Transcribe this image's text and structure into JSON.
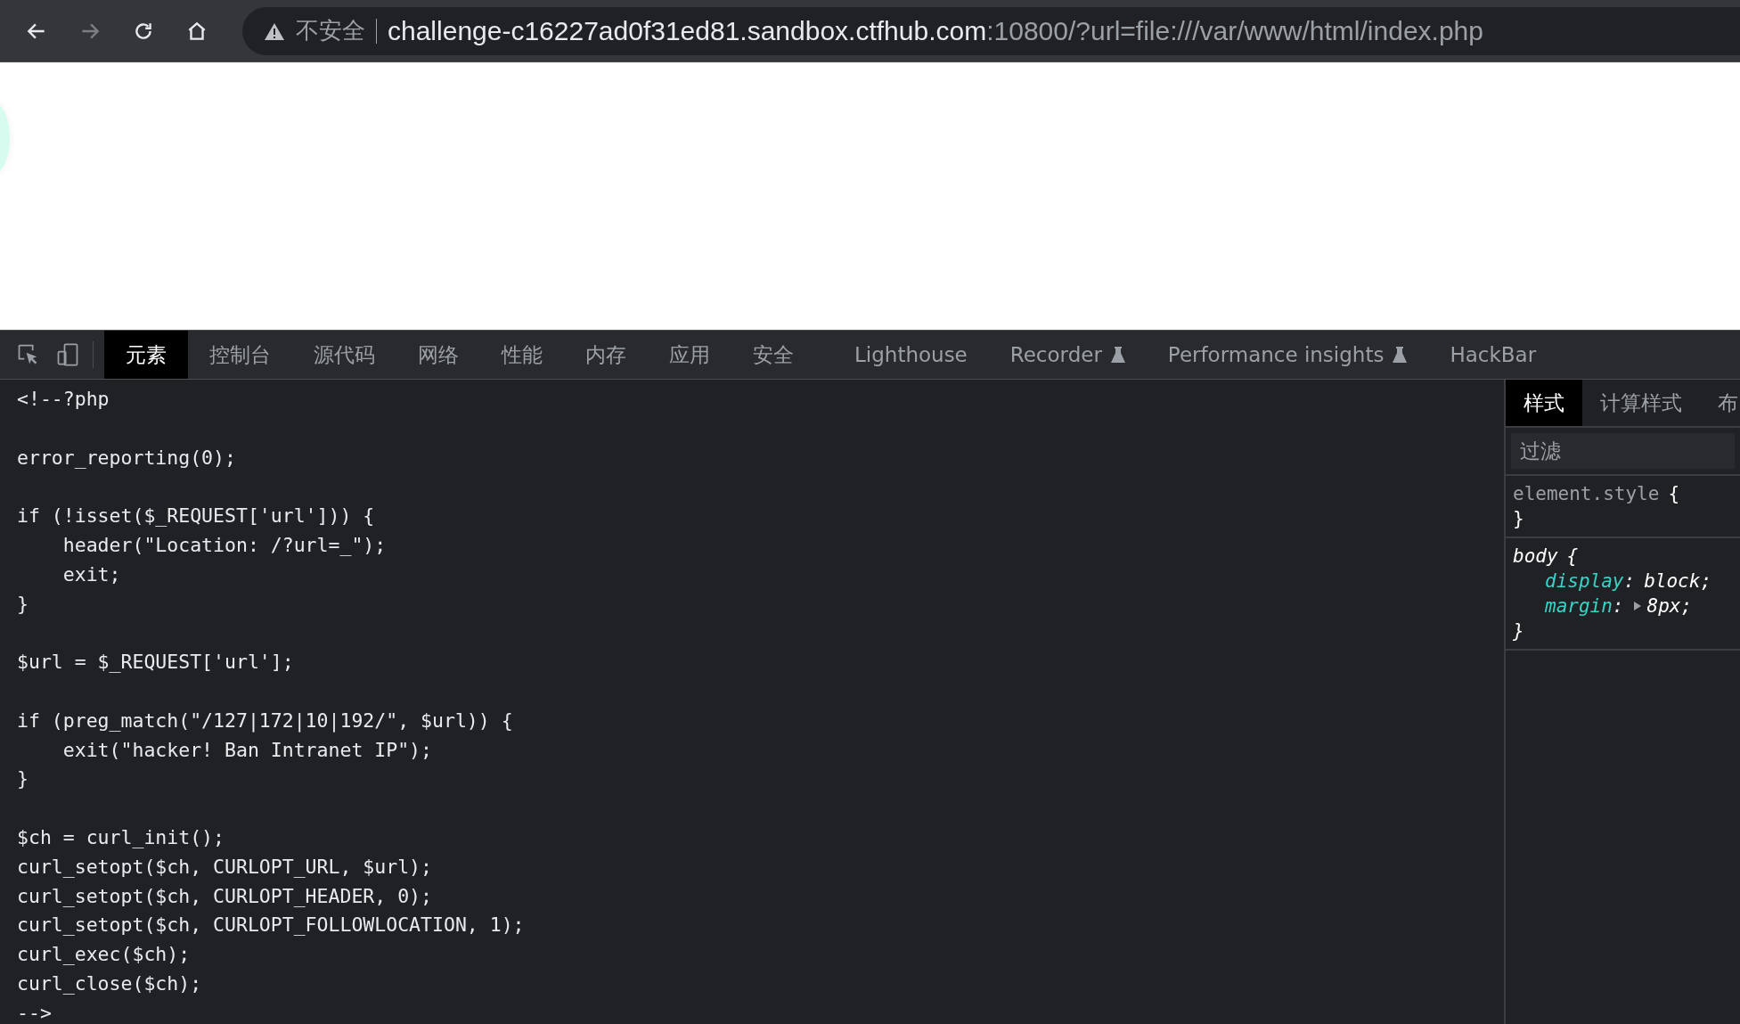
{
  "browser": {
    "nav_buttons": [
      {
        "kind": "back",
        "disabled": false
      },
      {
        "kind": "forward",
        "disabled": true
      },
      {
        "kind": "reload",
        "disabled": false
      },
      {
        "kind": "home",
        "disabled": false
      }
    ],
    "security_label": "不安全",
    "url_host": "challenge-c16227ad0f31ed81.sandbox.ctfhub.com",
    "url_rest": ":10800/?url=file:///var/www/html/index.php"
  },
  "devtools": {
    "tabs": [
      {
        "label": "元素",
        "selected": true,
        "experimental": false
      },
      {
        "label": "控制台",
        "selected": false,
        "experimental": false
      },
      {
        "label": "源代码",
        "selected": false,
        "experimental": false
      },
      {
        "label": "网络",
        "selected": false,
        "experimental": false
      },
      {
        "label": "性能",
        "selected": false,
        "experimental": false
      },
      {
        "label": "内存",
        "selected": false,
        "experimental": false
      },
      {
        "label": "应用",
        "selected": false,
        "experimental": false
      },
      {
        "label": "安全",
        "selected": false,
        "experimental": false
      },
      {
        "label": "Lighthouse",
        "selected": false,
        "experimental": false
      },
      {
        "label": "Recorder",
        "selected": false,
        "experimental": true
      },
      {
        "label": "Performance insights",
        "selected": false,
        "experimental": true
      },
      {
        "label": "HackBar",
        "selected": false,
        "experimental": false
      }
    ],
    "code_blocks": [
      [
        "<!--?php"
      ],
      [
        "error_reporting(0);"
      ],
      [
        "if (!isset($_REQUEST['url'])) {",
        "    header(\"Location: /?url=_\");",
        "    exit;",
        "}"
      ],
      [
        "$url = $_REQUEST['url'];"
      ],
      [
        "if (preg_match(\"/127|172|10|192/\", $url)) {",
        "    exit(\"hacker! Ban Intranet IP\");",
        "}"
      ],
      [
        "$ch = curl_init();",
        "curl_setopt($ch, CURLOPT_URL, $url);",
        "curl_setopt($ch, CURLOPT_HEADER, 0);",
        "curl_setopt($ch, CURLOPT_FOLLOWLOCATION, 1);",
        "curl_exec($ch);",
        "curl_close($ch);",
        "-->"
      ]
    ],
    "styles_panel": {
      "tabs": [
        {
          "label": "样式",
          "selected": true
        },
        {
          "label": "计算样式",
          "selected": false
        },
        {
          "label": "布",
          "selected": false
        }
      ],
      "filter": {
        "placeholder": "过滤"
      },
      "rules": [
        {
          "selector": "element.style",
          "user_agent": false,
          "open_brace": "{",
          "close_brace": "}"
        },
        {
          "selector": "body",
          "user_agent": true,
          "open_brace": "{",
          "close_brace": "}",
          "properties": [
            {
              "name": "display",
              "colon": ":",
              "value": "block;",
              "expandable": false
            },
            {
              "name": "margin",
              "colon": ":",
              "value": "8px;",
              "expandable": true
            }
          ]
        }
      ]
    }
  }
}
